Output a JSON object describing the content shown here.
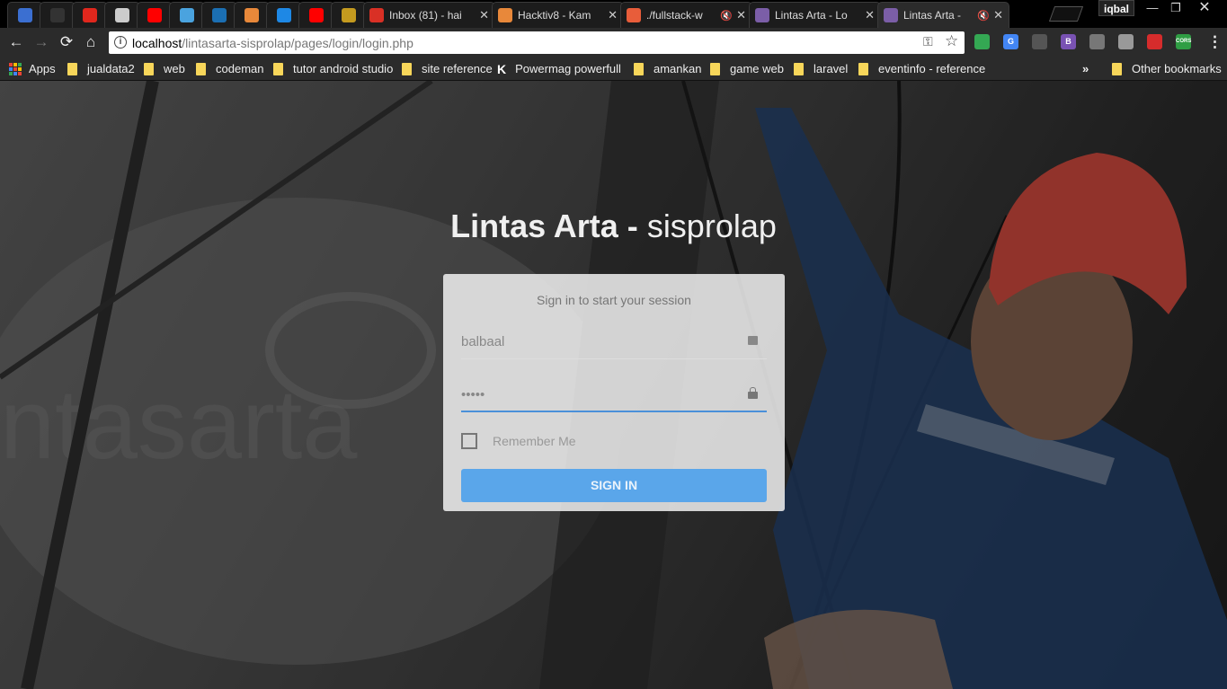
{
  "browser": {
    "tabs": [
      {
        "title": "",
        "favicon": "bookmark-icon",
        "color": "#3b6fd1",
        "pinned": true
      },
      {
        "title": "",
        "favicon": "github-icon",
        "color": "#333333",
        "pinned": true
      },
      {
        "title": "",
        "favicon": "udemy-icon",
        "color": "#e0271d",
        "pinned": true
      },
      {
        "title": "",
        "favicon": "file-icon",
        "color": "#cccccc",
        "pinned": true
      },
      {
        "title": "",
        "favicon": "youtube-icon",
        "color": "#ff0000",
        "pinned": true
      },
      {
        "title": "",
        "favicon": "star-icon",
        "color": "#4aa3df",
        "pinned": true
      },
      {
        "title": "",
        "favicon": "wave-icon",
        "color": "#1b6fb3",
        "pinned": true
      },
      {
        "title": "",
        "favicon": "fox-icon",
        "color": "#e8883a",
        "pinned": true
      },
      {
        "title": "",
        "favicon": "phpstorm-icon",
        "color": "#1e88e5",
        "pinned": true
      },
      {
        "title": "",
        "favicon": "youtube-icon",
        "color": "#ff0000",
        "pinned": true
      },
      {
        "title": "",
        "favicon": "xxi-icon",
        "color": "#c49a1f",
        "pinned": true
      },
      {
        "title": "Inbox (81) - hai",
        "favicon": "gmail-icon",
        "color": "#d93025",
        "pinned": false
      },
      {
        "title": "Hacktiv8 - Kam",
        "favicon": "fox-icon",
        "color": "#e8883a",
        "pinned": false
      },
      {
        "title": "./fullstack-w",
        "favicon": "u-icon",
        "color": "#e85d3a",
        "pinned": false,
        "muted": true
      },
      {
        "title": "Lintas Arta - Lo",
        "favicon": "lintas-icon",
        "color": "#7b5ea7",
        "pinned": false
      },
      {
        "title": "Lintas Arta -",
        "favicon": "lintas-icon",
        "color": "#7b5ea7",
        "pinned": false,
        "active": true,
        "muted": true
      }
    ],
    "profile_name": "iqbal",
    "url_host": "localhost",
    "url_path": "/lintasarta-sisprolap/pages/login/login.php",
    "extensions": [
      {
        "name": "google-drive-icon",
        "label": "",
        "color": "#34a853"
      },
      {
        "name": "google-translate-icon",
        "label": "G",
        "color": "#4285f4"
      },
      {
        "name": "pen-icon",
        "label": "",
        "color": "#555555"
      },
      {
        "name": "bootstrap-icon",
        "label": "B",
        "color": "#7952b3"
      },
      {
        "name": "globe-icon",
        "label": "",
        "color": "#777777"
      },
      {
        "name": "cloud-icon",
        "label": "",
        "color": "#999999"
      },
      {
        "name": "opera-icon",
        "label": "",
        "color": "#d62c2c"
      },
      {
        "name": "cors-icon",
        "label": "CORS",
        "color": "#2f9e44"
      }
    ],
    "bookmarks": [
      {
        "label": "Apps",
        "type": "apps"
      },
      {
        "label": "jualdata2",
        "type": "folder"
      },
      {
        "label": "web",
        "type": "folder"
      },
      {
        "label": "codeman",
        "type": "folder"
      },
      {
        "label": "tutor android studio",
        "type": "folder"
      },
      {
        "label": "site reference",
        "type": "folder"
      },
      {
        "label": "Powermag powerfull",
        "type": "k"
      },
      {
        "label": "amankan",
        "type": "folder"
      },
      {
        "label": "game web",
        "type": "folder"
      },
      {
        "label": "laravel",
        "type": "folder"
      },
      {
        "label": "eventinfo - reference",
        "type": "folder"
      }
    ],
    "overflow_label": "»",
    "other_bookmarks": "Other bookmarks"
  },
  "page": {
    "brand_bold": "Lintas Arta -",
    "brand_light": "sisprolap",
    "login_msg": "Sign in to start your session",
    "username_value": "balbaal",
    "password_value": "•••••",
    "remember_label": "Remember Me",
    "signin_label": "SIGN IN",
    "watermark_text": "ntasarta"
  }
}
